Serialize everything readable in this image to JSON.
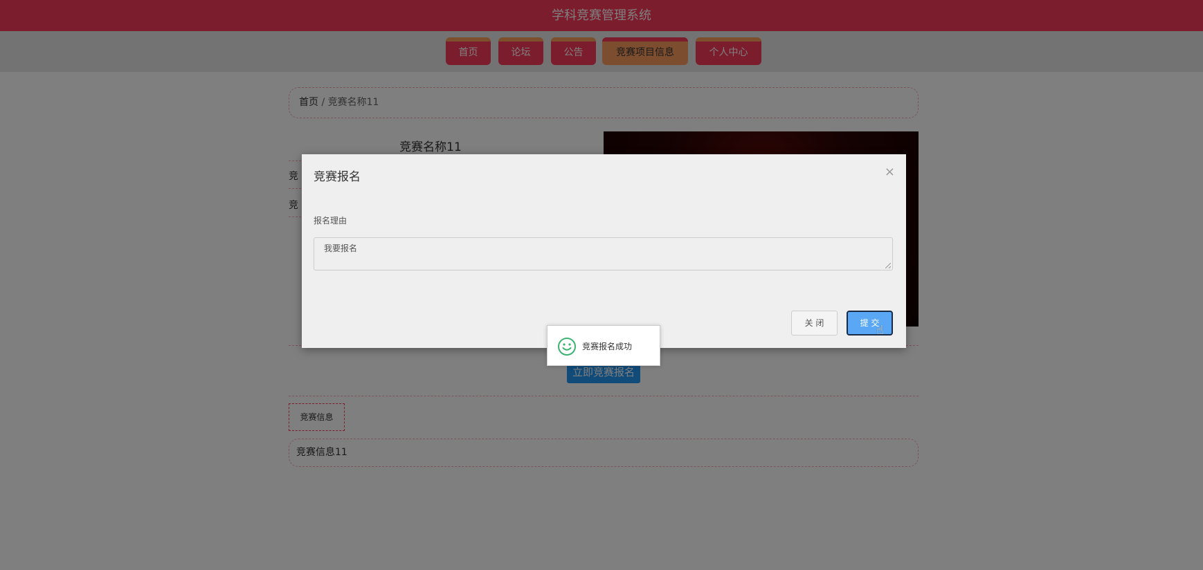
{
  "app_title": "学科竞赛管理系统",
  "nav": [
    "首页",
    "论坛",
    "公告",
    "竞赛项目信息",
    "个人中心"
  ],
  "breadcrumb": {
    "home": "首页",
    "sep": " / ",
    "current": "竞赛名称11"
  },
  "product_title": "竞赛名称11",
  "info_lines": [
    "竞",
    "竞"
  ],
  "enroll_button": "立即竞赛报名",
  "tab_label": "竞赛信息",
  "info_text": "竞赛信息11",
  "modal": {
    "title": "竞赛报名",
    "close_symbol": "×",
    "field_label": "报名理由",
    "textarea_value": "我要报名",
    "close_button": "关 闭",
    "submit_button": "提 交"
  },
  "toast": {
    "text": "竞赛报名成功",
    "icon": "smile-icon"
  },
  "colors": {
    "brand": "#f83a5a",
    "accent": "#fa9b60",
    "primary": "#2196f3"
  }
}
